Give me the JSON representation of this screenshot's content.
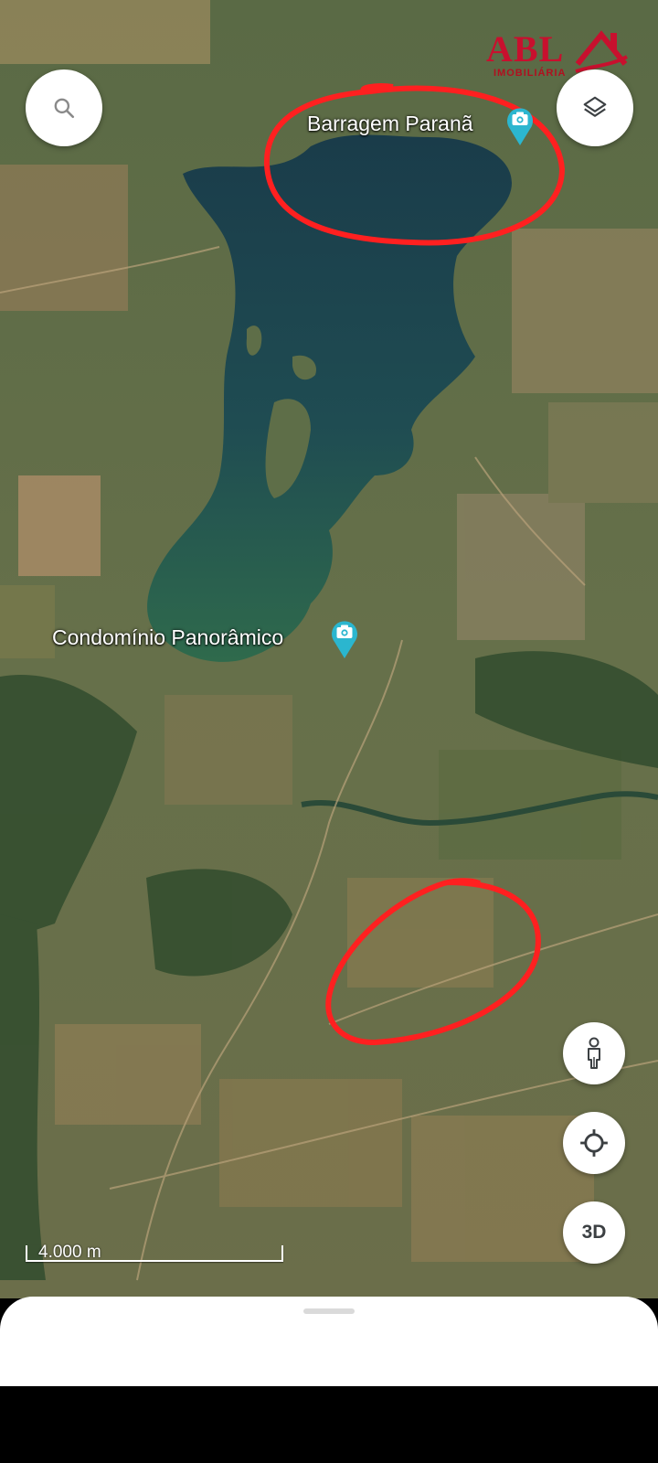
{
  "places": [
    {
      "name": "Barragem Paranã",
      "icon": "camera-pin-icon"
    },
    {
      "name": "Condomínio Panorâmico",
      "icon": "camera-pin-icon"
    }
  ],
  "watermark": {
    "brand": "ABL",
    "sub": "IMOBILIÁRIA",
    "color": "#c8102e"
  },
  "scale_bar": {
    "label": "4.000 m"
  },
  "controls": {
    "search": "search-icon",
    "layers": "layers-icon",
    "street_view": "pegman-icon",
    "my_location": "my-location-icon",
    "three_d_label": "3D"
  },
  "annotations": {
    "color": "#ff2020",
    "count": 2
  },
  "colors": {
    "pin": "#2bb6cf",
    "water": "#1e4a52",
    "circle": "#ff2020"
  }
}
